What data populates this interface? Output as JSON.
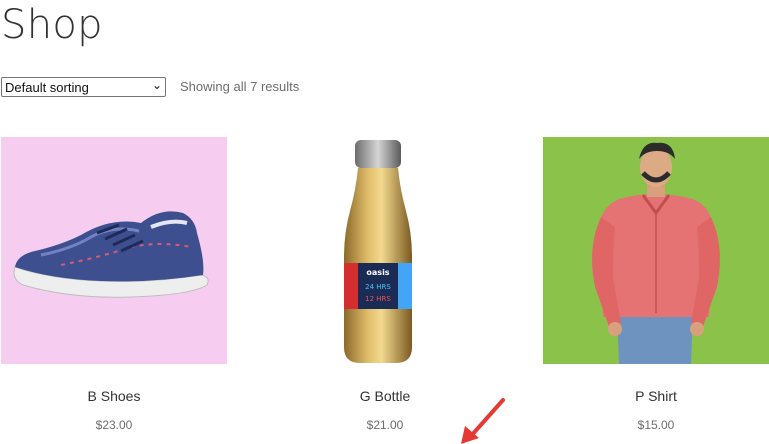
{
  "page": {
    "title": "Shop"
  },
  "toolbar": {
    "sorting_selected": "Default sorting",
    "result_count": "Showing all 7 results"
  },
  "colors": {
    "shoes_bg": "#f6cdf0",
    "bottle_bg": "#ffffff",
    "shirt_bg": "#8bc34a",
    "annotation_arrow": "#e53935"
  },
  "products": [
    {
      "name": "B Shoes",
      "price": "$23.00",
      "image": "blue-running-shoe"
    },
    {
      "name": "G Bottle",
      "price": "$21.00",
      "image": "gold-water-bottle"
    },
    {
      "name": "P Shirt",
      "price": "$15.00",
      "image": "man-in-pink-shirt"
    }
  ]
}
